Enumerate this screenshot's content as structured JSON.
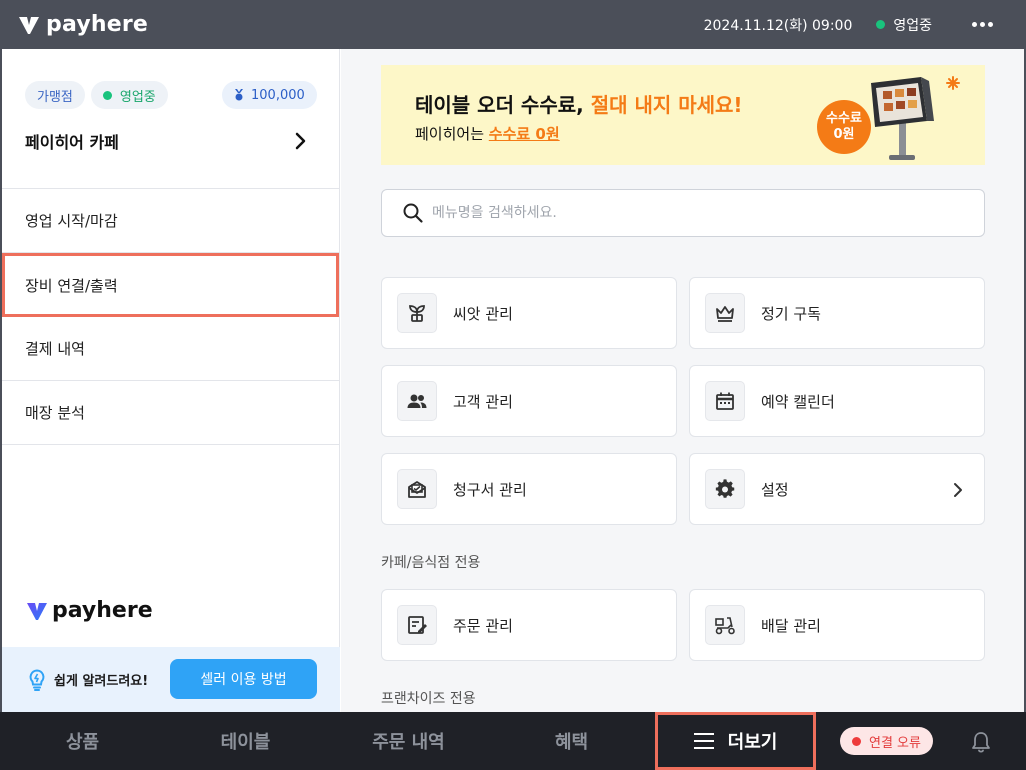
{
  "topbar": {
    "brand": "payhere",
    "datetime": "2024.11.12(화) 09:00",
    "status": "영업중"
  },
  "sidebar": {
    "badges": {
      "franchise": "가맹점",
      "open": "영업중",
      "points": "100,000"
    },
    "store_name": "페이히어 카페",
    "items": [
      {
        "label": "영업 시작/마감"
      },
      {
        "label": "장비 연결/출력"
      },
      {
        "label": "결제 내역"
      },
      {
        "label": "매장 분석"
      }
    ],
    "selected_item": "장비 연결/출력",
    "brand": "payhere",
    "help_text": "쉽게 알려드려요!",
    "help_button": "셀러 이용 방법"
  },
  "banner": {
    "title_plain": "테이블 오더 수수료, ",
    "title_accent": "절대 내지 마세요!",
    "sub_plain": "페이히어는 ",
    "sub_link": "수수료 0원",
    "fee_line1": "수수료",
    "fee_line2": "0원"
  },
  "search": {
    "placeholder": "메뉴명을 검색하세요."
  },
  "cards": {
    "seed": "씨앗 관리",
    "subscription": "정기 구독",
    "customer": "고객 관리",
    "calendar": "예약 캘린더",
    "invoice": "청구서 관리",
    "settings": "설정",
    "order": "주문 관리",
    "delivery": "배달 관리"
  },
  "sections": {
    "cafe": "카페/음식점 전용",
    "franchise": "프랜차이즈 전용"
  },
  "bottom_nav": {
    "products": "상품",
    "tables": "테이블",
    "orders": "주문 내역",
    "benefits": "혜택",
    "more": "더보기",
    "connection_error": "연결 오류"
  },
  "colors": {
    "accent_orange": "#f47b16",
    "highlight_red": "#ee6f5c",
    "status_green": "#19c37d",
    "error_red": "#ee3b3b",
    "button_blue": "#2fa3f6"
  }
}
